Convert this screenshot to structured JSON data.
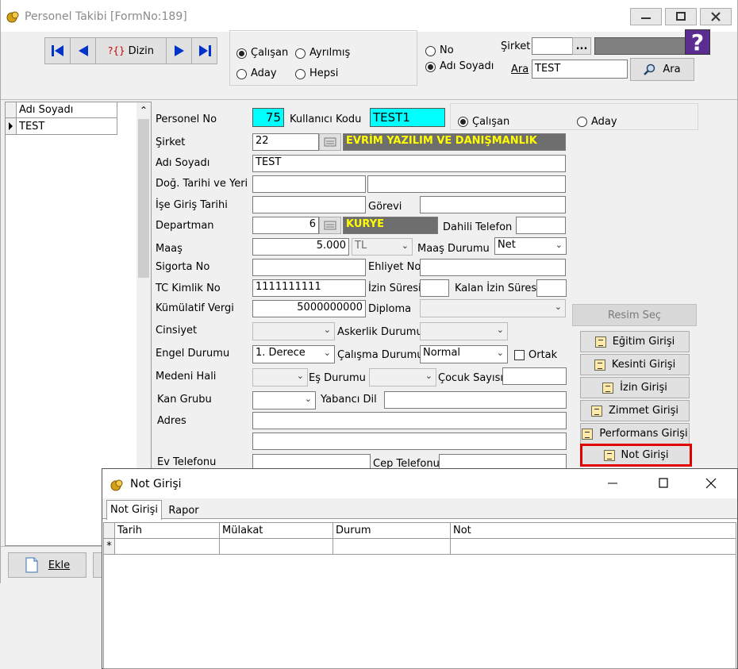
{
  "main_window": {
    "title": "Personel Takibi [FormNo:189]",
    "nav": {
      "dizin": "Dizin",
      "dizin_prefix": "?{}"
    },
    "filter": {
      "calisan": "Çalışan",
      "ayrilmis": "Ayrılmış",
      "aday": "Aday",
      "hepsi": "Hepsi"
    },
    "search_mode": {
      "no": "No",
      "adi_soyadi": "Adı Soyadı"
    },
    "search": {
      "sirket_label": "Şirket",
      "sirket_btn": "...",
      "ara_label": "Ara",
      "ara_value": "TEST",
      "ara_button": "Ara"
    }
  },
  "list": {
    "header": "Adı Soyadı",
    "rows": [
      "TEST"
    ]
  },
  "form": {
    "personel_no_label": "Personel No",
    "personel_no": "75",
    "kullanici_kodu_label": "Kullanıcı Kodu",
    "kullanici_kodu": "TEST1",
    "status_calisan": "Çalışan",
    "status_aday": "Aday",
    "sirket_label": "Şirket",
    "sirket_code": "22",
    "sirket_name": "EVRİM YAZILIM VE DANIŞMANLIK",
    "adi_soyadi_label": "Adı Soyadı",
    "adi_soyadi": "TEST",
    "dogum_label": "Doğ. Tarihi ve Yeri",
    "ise_giris_label": "İşe Giriş Tarihi",
    "gorevi_label": "Görevi",
    "departman_label": "Departman",
    "departman_code": "6",
    "departman_name": "KURYE",
    "dahili_label": "Dahili Telefon",
    "maas_label": "Maaş",
    "maas": "5.000",
    "maas_currency": "TL",
    "maas_durumu_label": "Maaş Durumu",
    "maas_durumu": "Net",
    "sigorta_label": "Sigorta No",
    "ehliyet_label": "Ehliyet No",
    "tc_label": "TC Kimlik No",
    "tc": "1111111111",
    "izin_suresi_label": "İzin Süresi",
    "kalan_izin_label": "Kalan İzin Süresi",
    "kumulatif_label": "Kümülatif Vergi",
    "kumulatif": "5000000000",
    "diploma_label": "Diploma",
    "cinsiyet_label": "Cinsiyet",
    "askerlik_label": "Askerlik Durumu",
    "engel_label": "Engel Durumu",
    "engel": "1. Derece",
    "calisma_label": "Çalışma Durumu",
    "calisma": "Normal",
    "ortak_label": "Ortak",
    "medeni_label": "Medeni Hali",
    "es_durumu_label": "Eş Durumu",
    "cocuk_label": "Çocuk Sayısı",
    "kan_label": "Kan Grubu",
    "yabanci_label": "Yabancı Dil",
    "adres_label": "Adres",
    "ev_tel_label": "Ev Telefonu",
    "cep_tel_label": "Cep Telefonu"
  },
  "side_buttons": {
    "resim_sec": "Resim Seç",
    "egitim": "Eğitim Girişi",
    "kesinti": "Kesinti Girişi",
    "izin": "İzin Girişi",
    "zimmet": "Zimmet Girişi",
    "performans": "Performans Girişi",
    "not": "Not Girişi"
  },
  "bottom": {
    "ekle": "Ekle"
  },
  "dialog": {
    "title": "Not Girişi",
    "tabs": [
      "Not Girişi",
      "Rapor"
    ],
    "columns": [
      "Tarih",
      "Mülakat",
      "Durum",
      "Not"
    ],
    "new_row_marker": "*"
  },
  "colors": {
    "highlight_cyan": "#00ffff",
    "dark_field": "#6e6e6e",
    "yellow_text": "#ffff00",
    "red_outline": "#e00000",
    "help_purple": "#5c2d91"
  }
}
